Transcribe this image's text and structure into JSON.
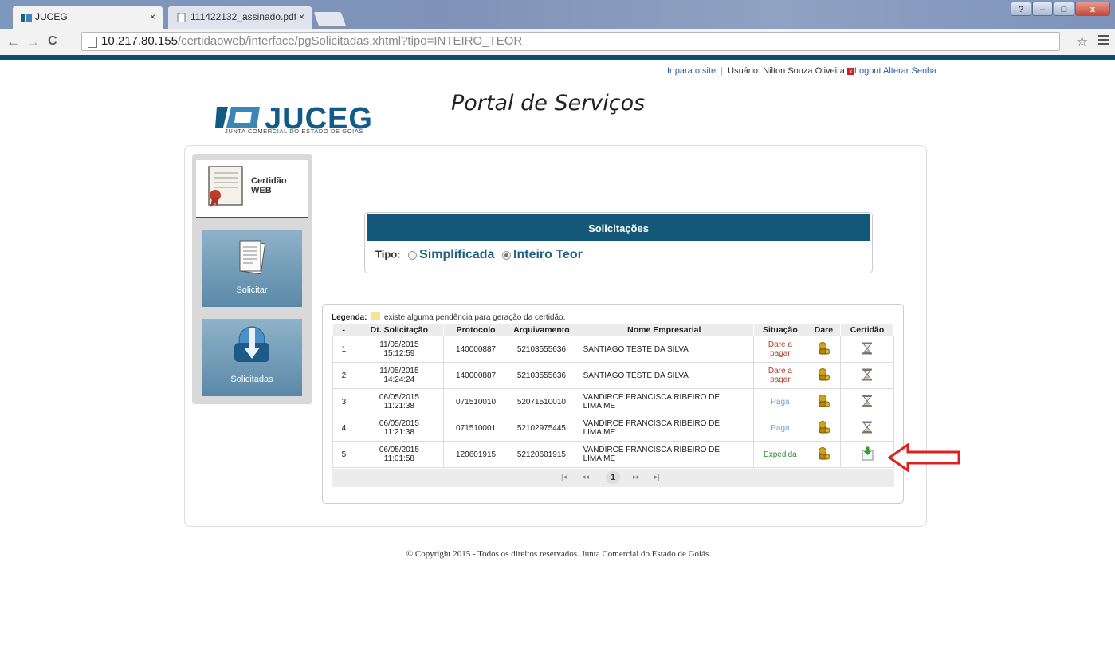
{
  "browser": {
    "tabs": [
      {
        "title": "JUCEG",
        "close": "×"
      },
      {
        "title": "111422132_assinado.pdf",
        "close": "×"
      }
    ],
    "url_host": "10.217.80.155",
    "url_path": "/certidaoweb/interface/pgSolicitadas.xhtml?tipo=INTEIRO_TEOR",
    "back": "←",
    "forward": "→",
    "reload": "C",
    "star": "☆",
    "window_controls": {
      "help": "?",
      "minimize": "–",
      "maximize": "□",
      "close": "x"
    }
  },
  "top_links": {
    "site_link": "Ir para o site",
    "separator": "|",
    "user_label": "Usuário: Nilton Souza Oliveira",
    "logout": "Logout",
    "alterar_senha": "Alterar Senha"
  },
  "logo": {
    "wordmark": "JUCEG",
    "subtitle": "JUNTA COMERCIAL DO ESTADO DE GOIÁS",
    "portal_title": "Portal de Serviços"
  },
  "sidebar": {
    "header": "Certidão WEB",
    "items": [
      {
        "label": "Solicitar"
      },
      {
        "label": "Solicitadas"
      }
    ]
  },
  "solicitacoes": {
    "title": "Solicitações",
    "tipo_label": "Tipo:",
    "options": [
      {
        "label": "Simplificada",
        "selected": false
      },
      {
        "label": "Inteiro Teor",
        "selected": true
      }
    ]
  },
  "legend": {
    "label": "Legenda:",
    "text": "existe alguma pendência para geração da certidão.",
    "color": "#f3e88f"
  },
  "table": {
    "headers": [
      "-",
      "Dt. Solicitação",
      "Protocolo",
      "Arquivamento",
      "Nome Empresarial",
      "Situação",
      "Dare",
      "Certidão"
    ],
    "rows": [
      {
        "n": "1",
        "date": "11/05/2015",
        "time": "15:12:59",
        "protocolo": "140000887",
        "arquivamento": "52103555636",
        "nome": "SANTIAGO TESTE DA SILVA",
        "situacao_1": "Dare a",
        "situacao_2": "pagar",
        "dare_icon": "money-bag-icon",
        "certidao_icon": "hourglass-icon"
      },
      {
        "n": "2",
        "date": "11/05/2015",
        "time": "14:24:24",
        "protocolo": "140000887",
        "arquivamento": "52103555636",
        "nome": "SANTIAGO TESTE DA SILVA",
        "situacao_1": "Dare a",
        "situacao_2": "pagar",
        "dare_icon": "money-bag-icon",
        "certidao_icon": "hourglass-icon"
      },
      {
        "n": "3",
        "date": "06/05/2015",
        "time": "11:21:38",
        "protocolo": "071510010",
        "arquivamento": "52071510010",
        "nome_1": "VANDIRCE FRANCISCA RIBEIRO DE",
        "nome_2": "LIMA ME",
        "situacao": "Paga",
        "dare_icon": "money-bag-icon",
        "certidao_icon": "hourglass-icon"
      },
      {
        "n": "4",
        "date": "06/05/2015",
        "time": "11:21:38",
        "protocolo": "071510001",
        "arquivamento": "52102975445",
        "nome_1": "VANDIRCE FRANCISCA RIBEIRO DE",
        "nome_2": "LIMA ME",
        "situacao": "Paga",
        "dare_icon": "money-bag-icon",
        "certidao_icon": "hourglass-icon"
      },
      {
        "n": "5",
        "date": "06/05/2015",
        "time": "11:01:58",
        "protocolo": "120601915",
        "arquivamento": "52120601915",
        "nome_1": "VANDIRCE FRANCISCA RIBEIRO DE",
        "nome_2": "LIMA ME",
        "situacao": "Expedida",
        "dare_icon": "money-bag-icon",
        "certidao_icon": "download-certificate-icon"
      }
    ]
  },
  "pager": {
    "first": "|◂",
    "prev": "◂◂",
    "current": "1",
    "next": "▸▸",
    "last": "▸|"
  },
  "footer": {
    "copyright": "© Copyright 2015 - Todos os direitos reservados. Junta Comercial do Estado de Goiás"
  },
  "colors": {
    "brand_blue": "#135878",
    "situacao_dare": "#b53a28",
    "situacao_paga": "#6ea6cf",
    "situacao_expedida": "#2f8f2f",
    "annotation_arrow": "#e02020"
  }
}
